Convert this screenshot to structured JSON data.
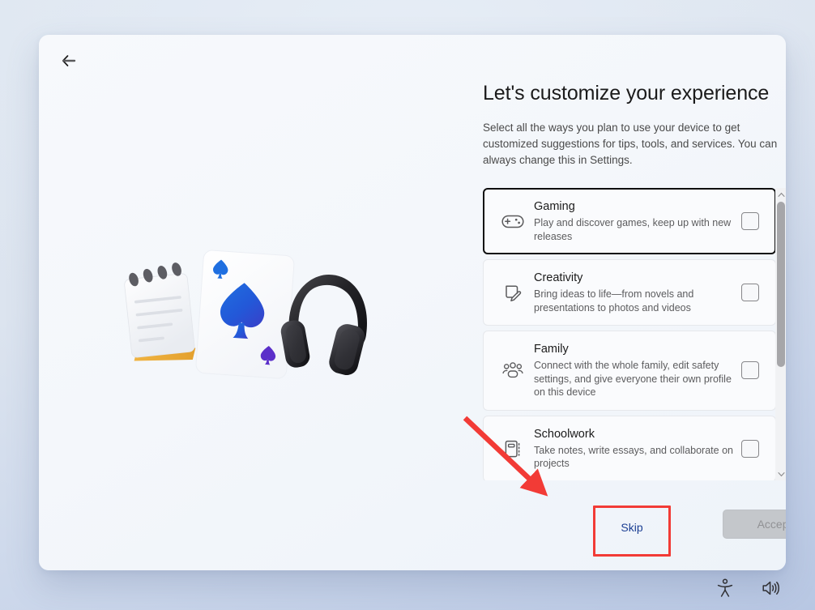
{
  "window": {
    "back_button_label": "Back",
    "back_icon": "arrow-left-icon"
  },
  "illustration": {
    "name": "customize-experience-illustration",
    "elements": [
      "notepad",
      "ace-of-spades-playing-card",
      "headphones"
    ]
  },
  "header": {
    "title": "Let's customize your experience",
    "description": "Select all the ways you plan to use your device to get customized suggestions for tips, tools, and services. You can always change this in Settings."
  },
  "options": [
    {
      "id": "gaming",
      "title": "Gaming",
      "description": "Play and discover games, keep up with new releases",
      "icon": "game-controller-icon",
      "checked": false,
      "focused": true
    },
    {
      "id": "creativity",
      "title": "Creativity",
      "description": "Bring ideas to life—from novels and presentations to photos and videos",
      "icon": "page-edit-icon",
      "checked": false,
      "focused": false
    },
    {
      "id": "family",
      "title": "Family",
      "description": "Connect with the whole family, edit safety settings, and give everyone their own profile on this device",
      "icon": "people-group-icon",
      "checked": false,
      "focused": false
    },
    {
      "id": "schoolwork",
      "title": "Schoolwork",
      "description": "Take notes, write essays, and collaborate on projects",
      "icon": "notebook-icon",
      "checked": false,
      "focused": false
    }
  ],
  "scrollbar": {
    "up_arrow": "chevron-up-icon",
    "down_arrow": "chevron-down-icon"
  },
  "actions": {
    "skip_label": "Skip",
    "accept_label": "Accept",
    "accept_disabled": true
  },
  "annotation": {
    "arrow_color": "#f23b36",
    "highlight_color": "#f23b36",
    "highlight_target": "Skip"
  },
  "systray": [
    {
      "id": "accessibility",
      "icon": "accessibility-icon"
    },
    {
      "id": "volume",
      "icon": "speaker-volume-icon"
    }
  ],
  "colors": {
    "accent_link": "#1c3f94",
    "page_background": "#dce4ef",
    "card_background": "#f5f8fc",
    "focus_outline": "#0f0f0f"
  }
}
